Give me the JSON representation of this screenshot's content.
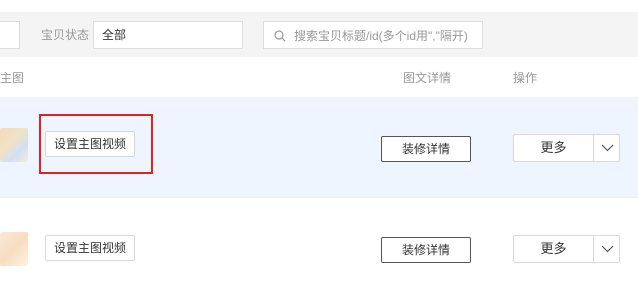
{
  "filter": {
    "status_label": "宝贝状态",
    "status_value": "全部",
    "search_placeholder": "搜索宝贝标题/id(多个id用\",\"隔开)"
  },
  "table": {
    "headers": {
      "main_image": "主图",
      "detail": "图文详情",
      "action": "操作"
    },
    "rows": [
      {
        "set_video_label": "设置主图视频",
        "decorate_label": "装修详情",
        "more_label": "更多"
      },
      {
        "set_video_label": "设置主图视频",
        "decorate_label": "装修详情",
        "more_label": "更多"
      }
    ]
  },
  "icons": {
    "search": "search-icon",
    "dropdown": "chevron-down-icon"
  }
}
